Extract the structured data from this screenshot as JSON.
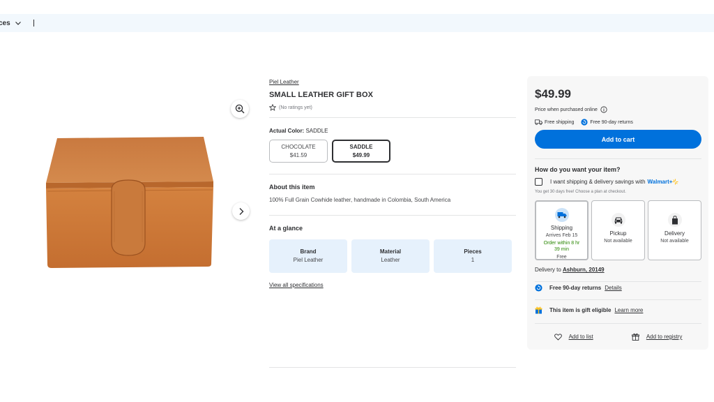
{
  "topbar": {
    "dept_label": "ces"
  },
  "product": {
    "brand": "Piel Leather",
    "title": "SMALL LEATHER GIFT BOX",
    "ratings_text": "(No ratings yet)",
    "actual_color_label": "Actual Color:",
    "actual_color_value": "SADDLE",
    "swatches": [
      {
        "name": "CHOCOLATE",
        "price": "$41.59"
      },
      {
        "name": "SADDLE",
        "price": "$49.99"
      }
    ],
    "about_title": "About this item",
    "about_text": "100% Full Grain Cowhide leather, handmade in Colombia, South America",
    "glance_title": "At a glance",
    "glance": [
      {
        "k": "Brand",
        "v": "Piel Leather"
      },
      {
        "k": "Material",
        "v": "Leather"
      },
      {
        "k": "Pieces",
        "v": "1"
      }
    ],
    "specs_link": "View all specifications"
  },
  "buybox": {
    "price": "$49.99",
    "price_note": "Price when purchased online",
    "free_shipping": "Free shipping",
    "free_returns": "Free 90-day returns",
    "add_to_cart": "Add to cart",
    "how_title": "How do you want your item?",
    "wplus_text": "I want shipping & delivery savings with",
    "wplus_brand": "Walmart+",
    "trial_text": "You get 30 days free! Choose a plan at checkout.",
    "options": [
      {
        "name": "Shipping",
        "line1": "Arrives Feb 15",
        "line2": "Order within 8 hr 39 min",
        "line3": "Free"
      },
      {
        "name": "Pickup",
        "line1": "Not available"
      },
      {
        "name": "Delivery",
        "line1": "Not available"
      }
    ],
    "delivery_to_label": "Delivery to",
    "delivery_to_value": "Ashburn, 20149",
    "returns_text": "Free 90-day returns",
    "returns_link": "Details",
    "gift_text": "This item is gift eligible",
    "gift_link": "Learn more",
    "add_to_list": "Add to list",
    "add_to_registry": "Add to registry"
  },
  "colors": {
    "brand_blue": "#0071dc",
    "green": "#2a8703",
    "glance_bg": "#e6f1fc",
    "panel_bg": "#f7f7f7"
  }
}
